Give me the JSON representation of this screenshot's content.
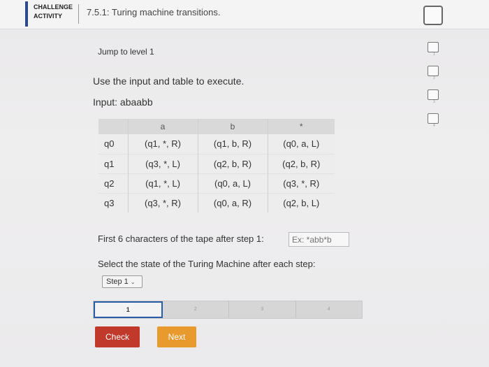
{
  "header": {
    "badge_line1": "CHALLENGE",
    "badge_line2": "ACTIVITY",
    "title": "7.5.1: Turing machine transitions."
  },
  "side_steps": [
    "1",
    "2",
    "3",
    "4"
  ],
  "jump_label": "Jump to level 1",
  "instructions": "Use the input and table to execute.",
  "input_line": "Input: abaabb",
  "table": {
    "headers": [
      "",
      "a",
      "b",
      "*"
    ],
    "rows": [
      [
        "q0",
        "(q1, *, R)",
        "(q1, b, R)",
        "(q0, a, L)"
      ],
      [
        "q1",
        "(q3, *, L)",
        "(q2, b, R)",
        "(q2, b, R)"
      ],
      [
        "q2",
        "(q1, *, L)",
        "(q0, a, L)",
        "(q3, *, R)"
      ],
      [
        "q3",
        "(q3, *, R)",
        "(q0, a, R)",
        "(q2, b, L)"
      ]
    ]
  },
  "tape_question": "First 6 characters of the tape after step 1:",
  "tape_placeholder": "Ex: *abb*b",
  "select_question": "Select the state of the Turing Machine after each step:",
  "step_select_value": "Step 1",
  "progress": {
    "segments": [
      "1",
      "2",
      "3",
      "4"
    ],
    "active_index": 0
  },
  "buttons": {
    "check": "Check",
    "next": "Next"
  },
  "colors": {
    "accent_blue": "#2a5da8",
    "check_red": "#c0392b",
    "next_orange": "#e89a2c"
  }
}
